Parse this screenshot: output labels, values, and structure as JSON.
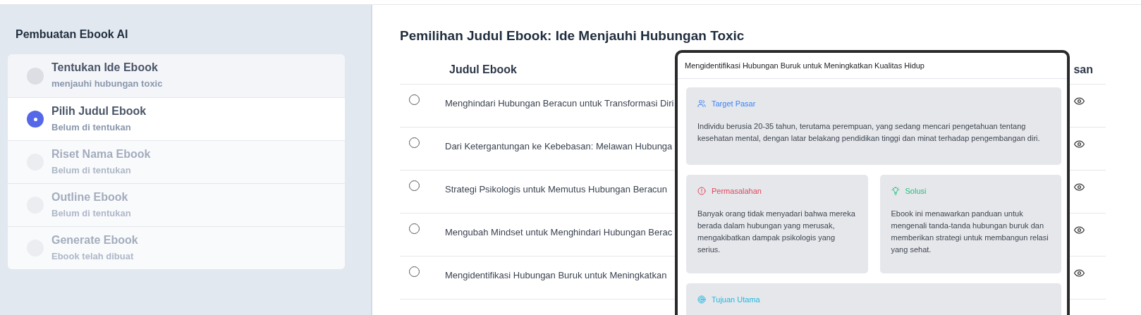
{
  "sidebar": {
    "title": "Pembuatan Ebook AI",
    "steps": [
      {
        "title": "Tentukan Ide Ebook",
        "subtitle": "menjauhi hubungan toxic",
        "selected": false,
        "disabled": false
      },
      {
        "title": "Pilih Judul Ebook",
        "subtitle": "Belum di tentukan",
        "selected": true,
        "disabled": false
      },
      {
        "title": "Riset Nama Ebook",
        "subtitle": "Belum di tentukan",
        "selected": false,
        "disabled": true
      },
      {
        "title": "Outline Ebook",
        "subtitle": "Belum di tentukan",
        "selected": false,
        "disabled": true
      },
      {
        "title": "Generate Ebook",
        "subtitle": "Ebook telah dibuat",
        "selected": false,
        "disabled": true
      }
    ]
  },
  "main": {
    "title": "Pemilihan Judul Ebook: Ide Menjauhi Hubungan Toxic",
    "table": {
      "columns": [
        "Judul Ebook",
        "san"
      ],
      "rows": [
        {
          "title": "Menghindari Hubungan Beracun untuk Transformasi Diri",
          "selected": false
        },
        {
          "title": "Dari Ketergantungan ke Kebebasan: Melawan Hubunga",
          "selected": false
        },
        {
          "title": "Strategi Psikologis untuk Memutus Hubungan Beracun",
          "selected": false
        },
        {
          "title": "Mengubah Mindset untuk Menghindari Hubungan Berac",
          "selected": false
        },
        {
          "title": "Mengidentifikasi Hubungan Buruk untuk Meningkatkan",
          "selected": false
        }
      ]
    }
  },
  "popover": {
    "title": "Mengidentifikasi Hubungan Buruk untuk Meningkatkan Kualitas Hidup",
    "sections": [
      {
        "kind": "target",
        "label": "Target Pasar",
        "color": "#3b82f6",
        "text": "Individu berusia 20-35 tahun, terutama perempuan, yang sedang mencari pengetahuan tentang kesehatan mental, dengan latar belakang pendidikan tinggi dan minat terhadap pengembangan diri."
      },
      {
        "kind": "problem",
        "label": "Permasalahan",
        "color": "#e0475b",
        "text": "Banyak orang tidak menyadari bahwa mereka berada dalam hubungan yang merusak, mengakibatkan dampak psikologis yang serius."
      },
      {
        "kind": "solution",
        "label": "Solusi",
        "color": "#22c07a",
        "text": "Ebook ini menawarkan panduan untuk mengenali tanda-tanda hubungan buruk dan memberikan strategi untuk membangun relasi yang sehat."
      },
      {
        "kind": "goal",
        "label": "Tujuan Utama",
        "color": "#22b8e0"
      }
    ]
  }
}
